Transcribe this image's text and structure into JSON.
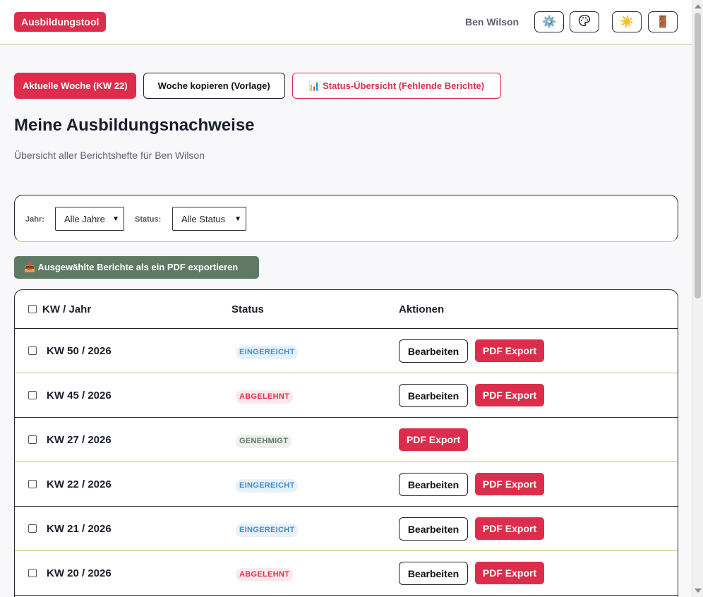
{
  "header": {
    "brand": "Ausbildungstool",
    "user_name": "Ben Wilson",
    "icons": [
      "gear-icon",
      "palette-icon",
      "sun-icon",
      "door-icon"
    ],
    "icon_glyphs": [
      "⚙️",
      "🎨",
      "☀️",
      "🚪"
    ]
  },
  "actions": {
    "current_week": "Aktuelle Woche (KW 22)",
    "copy_week": "Woche kopieren (Vorlage)",
    "status_overview": "📊 Status-Übersicht (Fehlende Berichte)"
  },
  "page": {
    "title": "Meine Ausbildungsnachweise",
    "subtitle": "Übersicht aller Berichtshefte für Ben Wilson"
  },
  "filters": {
    "year_label": "Jahr:",
    "year_value": "Alle Jahre",
    "status_label": "Status:",
    "status_value": "Alle Status"
  },
  "export_button": "📥 Ausgewählte Berichte als ein PDF exportieren",
  "table": {
    "headers": [
      "KW / Jahr",
      "Status",
      "Aktionen"
    ],
    "edit_label": "Bearbeiten",
    "pdf_label": "PDF Export",
    "rows": [
      {
        "kw": "KW 50 / 2026",
        "status": "EINGEREICHT",
        "status_type": "submitted",
        "editable": true
      },
      {
        "kw": "KW 45 / 2026",
        "status": "ABGELEHNT",
        "status_type": "rejected",
        "editable": true
      },
      {
        "kw": "KW 27 / 2026",
        "status": "GENEHMIGT",
        "status_type": "approved",
        "editable": false
      },
      {
        "kw": "KW 22 / 2026",
        "status": "EINGEREICHT",
        "status_type": "submitted",
        "editable": true
      },
      {
        "kw": "KW 21 / 2026",
        "status": "EINGEREICHT",
        "status_type": "submitted",
        "editable": true
      },
      {
        "kw": "KW 20 / 2026",
        "status": "ABGELEHNT",
        "status_type": "rejected",
        "editable": true
      }
    ]
  },
  "colors": {
    "accent": "#dc2e4c",
    "export_green": "#5e7a63",
    "submitted_text": "#3b8ed8",
    "submitted_bg": "#e6f1fb",
    "rejected_text": "#dc2e4c",
    "rejected_bg": "#fce8ec",
    "approved_text": "#5f7a66",
    "approved_bg": "#edf1ee"
  }
}
